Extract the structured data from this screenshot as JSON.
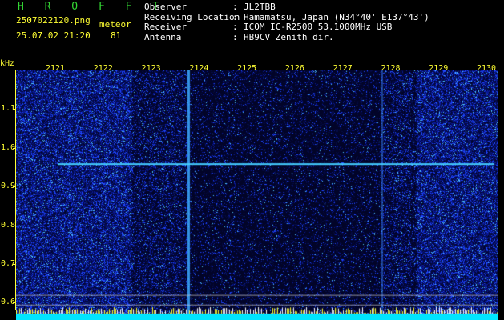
{
  "header": {
    "title": "H R O F F T",
    "filename": "2507022120.png",
    "category": "meteor",
    "datetime": "25.07.02 21:20",
    "count": "81"
  },
  "info": {
    "rows": [
      {
        "key": "Observer",
        "value": "JL2TBB"
      },
      {
        "key": "Receiving Location",
        "value": "Hamamatsu, Japan (N34°40' E137°43')"
      },
      {
        "key": "Receiver",
        "value": "ICOM IC-R2500 53.1000MHz USB"
      },
      {
        "key": "Antenna",
        "value": "HB9CV Zenith dir."
      }
    ],
    "separator": ":"
  },
  "chart_data": {
    "type": "heatmap",
    "y_unit": "kHz",
    "x_ticks": [
      "2121",
      "2122",
      "2123",
      "2124",
      "2125",
      "2126",
      "2127",
      "2128",
      "2129",
      "2130"
    ],
    "y_ticks": [
      "1.1",
      "1.0",
      "0.9",
      "0.8",
      "0.7",
      "0.6"
    ],
    "ylim": [
      0.58,
      1.2
    ],
    "horizontal_trace_khz": 0.96,
    "colors": {
      "background": "#000000",
      "noise_high": "#1a3fff",
      "noise_low": "#06105a",
      "trace": "#44ccff",
      "labels": "#ffff33",
      "bottom_bar": "#00e5ff"
    }
  }
}
